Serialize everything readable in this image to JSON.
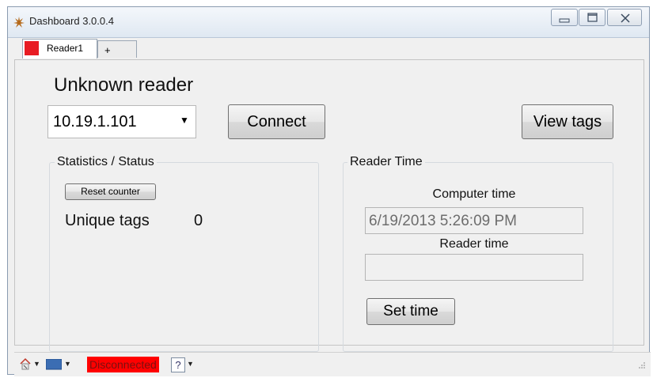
{
  "window": {
    "title": "Dashboard 3.0.0.4"
  },
  "tabs": [
    {
      "label": "Reader1",
      "color": "#e81c23"
    },
    {
      "label": "+"
    }
  ],
  "reader": {
    "title": "Unknown reader",
    "ip_address": "10.19.1.101",
    "connect_label": "Connect",
    "view_tags_label": "View tags"
  },
  "statistics": {
    "group_label": "Statistics / Status",
    "reset_label": "Reset counter",
    "unique_tags_label": "Unique tags",
    "unique_tags_value": "0"
  },
  "reader_time": {
    "group_label": "Reader Time",
    "computer_time_label": "Computer time",
    "computer_time_value": "6/19/2013 5:26:09 PM",
    "reader_time_label": "Reader time",
    "reader_time_value": "",
    "set_time_label": "Set time"
  },
  "statusbar": {
    "connection_status": "Disconnected",
    "connection_color": "#ff0000",
    "help_label": "?",
    "icons": [
      "home-icon",
      "monitor-icon",
      "help-icon"
    ]
  }
}
